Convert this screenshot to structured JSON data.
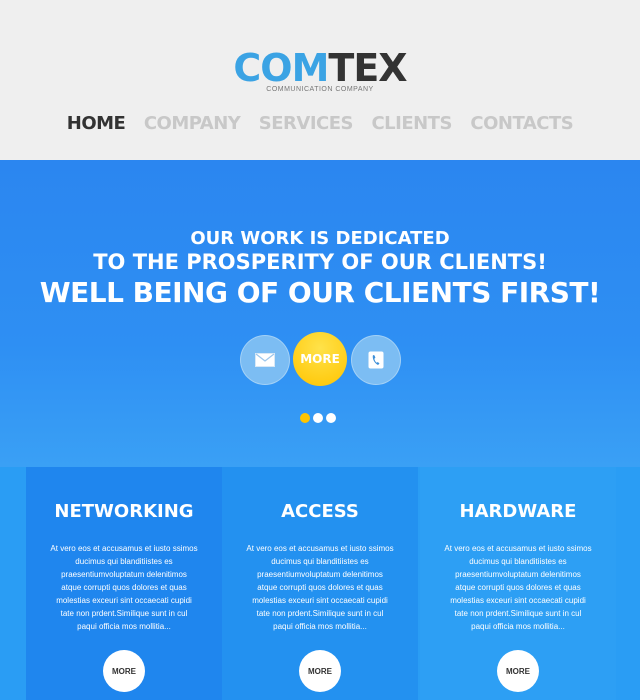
{
  "logo": {
    "part1": "COM",
    "part2": "TEX",
    "tagline": "COMMUNICATION COMPANY"
  },
  "nav": [
    {
      "label": "HOME"
    },
    {
      "label": "COMPANY"
    },
    {
      "label": "SERVICES"
    },
    {
      "label": "CLIENTS"
    },
    {
      "label": "CONTACTS"
    }
  ],
  "hero": {
    "line1": "OUR WORK IS DEDICATED",
    "line2": "TO THE PROSPERITY OF OUR CLIENTS!",
    "line3": "WELL BEING OF OUR CLIENTS FIRST!",
    "more_label": "MORE",
    "slides_total": 3,
    "slide_active": 1
  },
  "features": [
    {
      "title": "NETWORKING",
      "text": "At vero eos et accusamus et iusto ssimos ducimus qui blanditiistes es praesentiumvoluptatum delenitimos atque corrupti quos dolores et quas molestias exceuri sint occaecati cupidi tate non prdent.Similique sunt in cul paqui officia mos mollitia...",
      "more": "MORE"
    },
    {
      "title": "ACCESS",
      "text": "At vero eos et accusamus et iusto ssimos ducimus qui blanditiistes es praesentiumvoluptatum delenitimos atque corrupti quos dolores et quas molestias exceuri sint occaecati cupidi tate non prdent.Similique sunt in cul paqui officia mos mollitia...",
      "more": "MORE"
    },
    {
      "title": "HARDWARE",
      "text": "At vero eos et accusamus et iusto ssimos ducimus qui blanditiistes es praesentiumvoluptatum delenitimos atque corrupti quos dolores et quas molestias exceuri sint occaecati cupidi tate non prdent.Similique sunt in cul paqui officia mos mollitia...",
      "more": "MORE"
    }
  ],
  "colors": {
    "accent": "#2b86f0",
    "logo_blue": "#3ba3e4",
    "yellow": "#ffc400"
  }
}
